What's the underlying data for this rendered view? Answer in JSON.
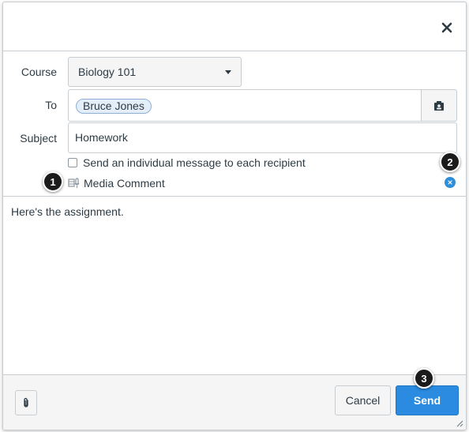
{
  "form": {
    "course_label": "Course",
    "course_value": "Biology 101",
    "to_label": "To",
    "recipient": "Bruce Jones",
    "subject_label": "Subject",
    "subject_value": "Homework",
    "individual_message_label": "Send an individual message to each recipient",
    "media_comment_label": "Media Comment"
  },
  "message": {
    "body": "Here's the assignment."
  },
  "footer": {
    "cancel_label": "Cancel",
    "send_label": "Send"
  },
  "callouts": [
    "1",
    "2",
    "3"
  ],
  "icons": {
    "close": "close-icon",
    "address_book": "address-book-icon",
    "media": "media-comment-icon",
    "remove": "remove-x-icon",
    "attach": "paperclip-icon"
  },
  "colors": {
    "primary": "#2a8be1",
    "token_bg": "#e4eef9",
    "border": "#c7cdd1"
  }
}
